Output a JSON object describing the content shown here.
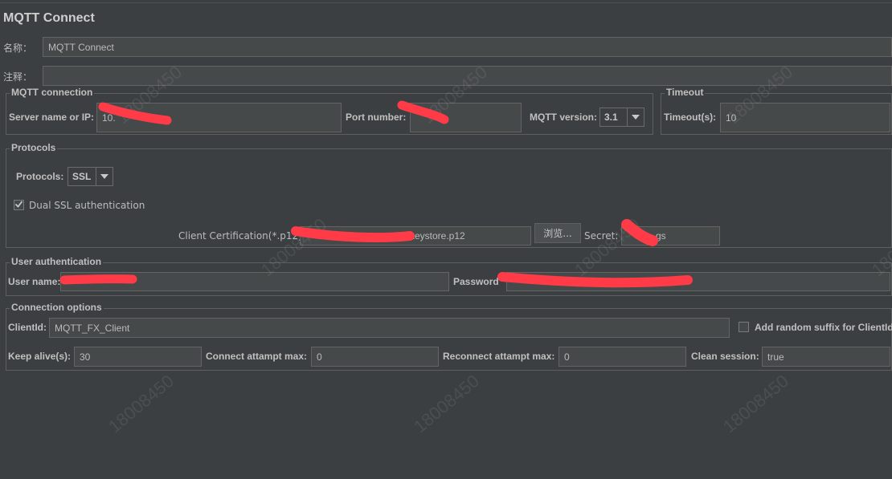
{
  "window": {
    "title": "MQTT Connect"
  },
  "general": {
    "name_label": "名称：",
    "name_value": "MQTT Connect",
    "comment_label": "注释：",
    "comment_value": ""
  },
  "mqtt_connection": {
    "legend": "MQTT connection",
    "server_label": "Server name or IP:",
    "server_value": "10.",
    "port_label": "Port number:",
    "port_value": "",
    "version_label": "MQTT version:",
    "version_value": "3.1"
  },
  "timeout": {
    "legend": "Timeout",
    "label": "Timeout(s):",
    "value": "10"
  },
  "protocols": {
    "legend": "Protocols",
    "protocol_label": "Protocols:",
    "protocol_value": "SSL",
    "dual_ssl_label": "Dual SSL authentication",
    "dual_ssl_checked": true,
    "cert_label": "Client Certification(*.p12):",
    "cert_value": "keystore.p12",
    "browse_label": "浏览...",
    "secret_label": "Secret:",
    "secret_value": "gs"
  },
  "user_auth": {
    "legend": "User authentication",
    "username_label": "User name:",
    "username_value": "",
    "password_label": "Password",
    "password_value": ""
  },
  "connection_options": {
    "legend": "Connection options",
    "clientid_label": "ClientId:",
    "clientid_value": "MQTT_FX_Client",
    "random_suffix_label": "Add random suffix for ClientId",
    "random_suffix_checked": false,
    "keepalive_label": "Keep alive(s):",
    "keepalive_value": "30",
    "connect_max_label": "Connect attampt max:",
    "connect_max_value": "0",
    "reconnect_max_label": "Reconnect attampt max:",
    "reconnect_max_value": "0",
    "clean_session_label": "Clean session:",
    "clean_session_value": "true"
  },
  "watermark": {
    "text": "18008450"
  },
  "colors": {
    "background": "#3c3f41",
    "field": "#45494a",
    "border": "#646464",
    "text": "#bbbbbb",
    "redaction": "#ff3b47"
  },
  "icons": {
    "combo_arrow": "chevron-down-icon",
    "checkbox_check": "check-icon"
  }
}
